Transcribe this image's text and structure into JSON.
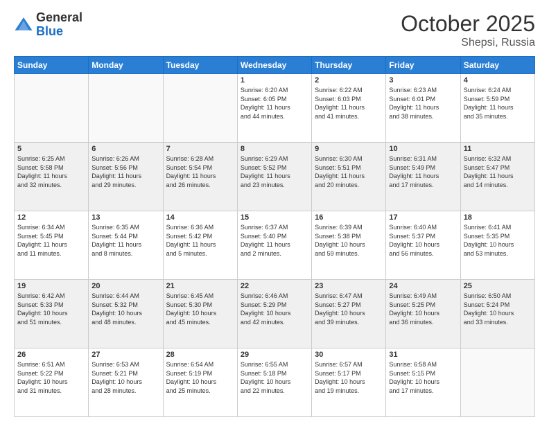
{
  "logo": {
    "general": "General",
    "blue": "Blue"
  },
  "header": {
    "month": "October 2025",
    "location": "Shepsi, Russia"
  },
  "days_of_week": [
    "Sunday",
    "Monday",
    "Tuesday",
    "Wednesday",
    "Thursday",
    "Friday",
    "Saturday"
  ],
  "weeks": [
    {
      "shaded": false,
      "days": [
        {
          "num": "",
          "info": ""
        },
        {
          "num": "",
          "info": ""
        },
        {
          "num": "",
          "info": ""
        },
        {
          "num": "1",
          "info": "Sunrise: 6:20 AM\nSunset: 6:05 PM\nDaylight: 11 hours\nand 44 minutes."
        },
        {
          "num": "2",
          "info": "Sunrise: 6:22 AM\nSunset: 6:03 PM\nDaylight: 11 hours\nand 41 minutes."
        },
        {
          "num": "3",
          "info": "Sunrise: 6:23 AM\nSunset: 6:01 PM\nDaylight: 11 hours\nand 38 minutes."
        },
        {
          "num": "4",
          "info": "Sunrise: 6:24 AM\nSunset: 5:59 PM\nDaylight: 11 hours\nand 35 minutes."
        }
      ]
    },
    {
      "shaded": true,
      "days": [
        {
          "num": "5",
          "info": "Sunrise: 6:25 AM\nSunset: 5:58 PM\nDaylight: 11 hours\nand 32 minutes."
        },
        {
          "num": "6",
          "info": "Sunrise: 6:26 AM\nSunset: 5:56 PM\nDaylight: 11 hours\nand 29 minutes."
        },
        {
          "num": "7",
          "info": "Sunrise: 6:28 AM\nSunset: 5:54 PM\nDaylight: 11 hours\nand 26 minutes."
        },
        {
          "num": "8",
          "info": "Sunrise: 6:29 AM\nSunset: 5:52 PM\nDaylight: 11 hours\nand 23 minutes."
        },
        {
          "num": "9",
          "info": "Sunrise: 6:30 AM\nSunset: 5:51 PM\nDaylight: 11 hours\nand 20 minutes."
        },
        {
          "num": "10",
          "info": "Sunrise: 6:31 AM\nSunset: 5:49 PM\nDaylight: 11 hours\nand 17 minutes."
        },
        {
          "num": "11",
          "info": "Sunrise: 6:32 AM\nSunset: 5:47 PM\nDaylight: 11 hours\nand 14 minutes."
        }
      ]
    },
    {
      "shaded": false,
      "days": [
        {
          "num": "12",
          "info": "Sunrise: 6:34 AM\nSunset: 5:45 PM\nDaylight: 11 hours\nand 11 minutes."
        },
        {
          "num": "13",
          "info": "Sunrise: 6:35 AM\nSunset: 5:44 PM\nDaylight: 11 hours\nand 8 minutes."
        },
        {
          "num": "14",
          "info": "Sunrise: 6:36 AM\nSunset: 5:42 PM\nDaylight: 11 hours\nand 5 minutes."
        },
        {
          "num": "15",
          "info": "Sunrise: 6:37 AM\nSunset: 5:40 PM\nDaylight: 11 hours\nand 2 minutes."
        },
        {
          "num": "16",
          "info": "Sunrise: 6:39 AM\nSunset: 5:38 PM\nDaylight: 10 hours\nand 59 minutes."
        },
        {
          "num": "17",
          "info": "Sunrise: 6:40 AM\nSunset: 5:37 PM\nDaylight: 10 hours\nand 56 minutes."
        },
        {
          "num": "18",
          "info": "Sunrise: 6:41 AM\nSunset: 5:35 PM\nDaylight: 10 hours\nand 53 minutes."
        }
      ]
    },
    {
      "shaded": true,
      "days": [
        {
          "num": "19",
          "info": "Sunrise: 6:42 AM\nSunset: 5:33 PM\nDaylight: 10 hours\nand 51 minutes."
        },
        {
          "num": "20",
          "info": "Sunrise: 6:44 AM\nSunset: 5:32 PM\nDaylight: 10 hours\nand 48 minutes."
        },
        {
          "num": "21",
          "info": "Sunrise: 6:45 AM\nSunset: 5:30 PM\nDaylight: 10 hours\nand 45 minutes."
        },
        {
          "num": "22",
          "info": "Sunrise: 6:46 AM\nSunset: 5:29 PM\nDaylight: 10 hours\nand 42 minutes."
        },
        {
          "num": "23",
          "info": "Sunrise: 6:47 AM\nSunset: 5:27 PM\nDaylight: 10 hours\nand 39 minutes."
        },
        {
          "num": "24",
          "info": "Sunrise: 6:49 AM\nSunset: 5:25 PM\nDaylight: 10 hours\nand 36 minutes."
        },
        {
          "num": "25",
          "info": "Sunrise: 6:50 AM\nSunset: 5:24 PM\nDaylight: 10 hours\nand 33 minutes."
        }
      ]
    },
    {
      "shaded": false,
      "days": [
        {
          "num": "26",
          "info": "Sunrise: 6:51 AM\nSunset: 5:22 PM\nDaylight: 10 hours\nand 31 minutes."
        },
        {
          "num": "27",
          "info": "Sunrise: 6:53 AM\nSunset: 5:21 PM\nDaylight: 10 hours\nand 28 minutes."
        },
        {
          "num": "28",
          "info": "Sunrise: 6:54 AM\nSunset: 5:19 PM\nDaylight: 10 hours\nand 25 minutes."
        },
        {
          "num": "29",
          "info": "Sunrise: 6:55 AM\nSunset: 5:18 PM\nDaylight: 10 hours\nand 22 minutes."
        },
        {
          "num": "30",
          "info": "Sunrise: 6:57 AM\nSunset: 5:17 PM\nDaylight: 10 hours\nand 19 minutes."
        },
        {
          "num": "31",
          "info": "Sunrise: 6:58 AM\nSunset: 5:15 PM\nDaylight: 10 hours\nand 17 minutes."
        },
        {
          "num": "",
          "info": ""
        }
      ]
    }
  ]
}
